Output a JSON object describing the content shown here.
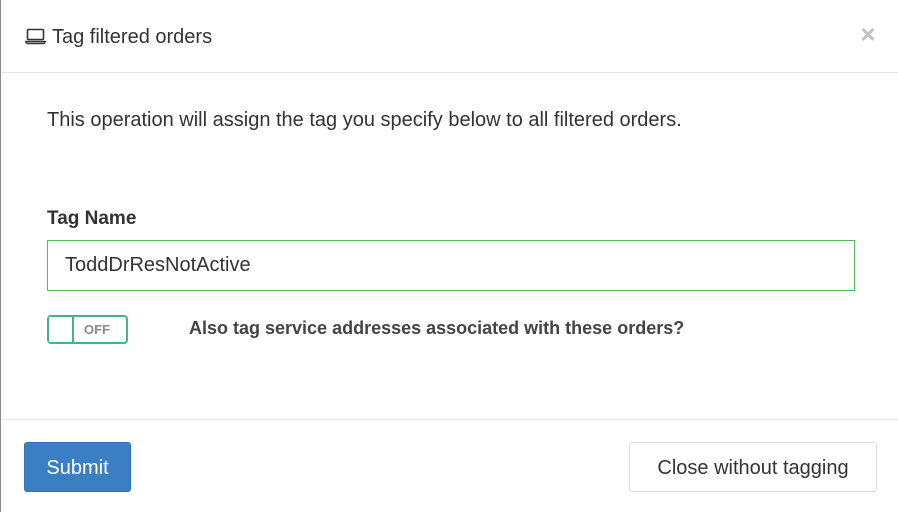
{
  "header": {
    "icon": "laptop-icon",
    "title": "Tag filtered orders",
    "close_label": "×"
  },
  "body": {
    "description": "This operation will assign the tag you specify below to all filtered orders.",
    "tag_name_label": "Tag Name",
    "tag_name_value": "ToddDrResNotActive",
    "toggle": {
      "state": "OFF",
      "label": "Also tag service addresses associated with these orders?"
    }
  },
  "footer": {
    "submit_label": "Submit",
    "close_label": "Close without tagging"
  },
  "colors": {
    "primary": "#3a7fc4",
    "input_border": "#5cb85c",
    "toggle_border": "#4cae8a"
  }
}
